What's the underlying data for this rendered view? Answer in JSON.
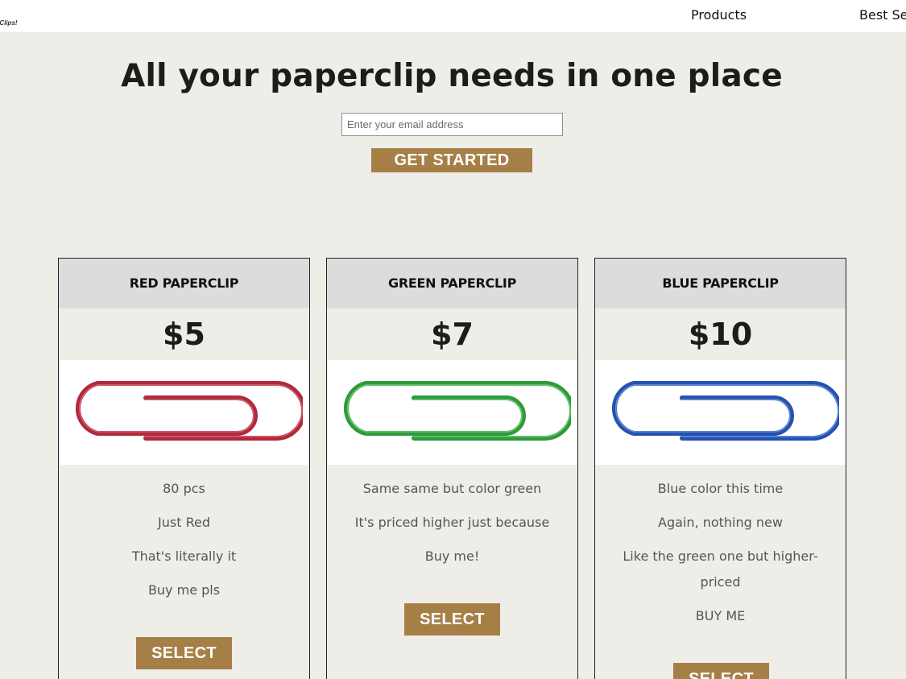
{
  "header": {
    "logo_text": "r Clips!",
    "nav": [
      {
        "label": "Products"
      },
      {
        "label": "Best Se"
      }
    ]
  },
  "hero": {
    "title": "All your paperclip needs in one place",
    "email_placeholder": "Enter your email address",
    "cta_label": "GET STARTED"
  },
  "colors": {
    "accent": "#a67f46",
    "background": "#eeede8",
    "card_header": "#dcdcdc",
    "red_clip": "#b02a3c",
    "green_clip": "#2f9a3a",
    "blue_clip": "#2552b0"
  },
  "products": [
    {
      "name": "RED PAPERCLIP",
      "price": "$5",
      "image_icon": "red-paperclip",
      "features": [
        "80 pcs",
        "Just Red",
        "That's literally it",
        "Buy me pls"
      ],
      "button_label": "SELECT"
    },
    {
      "name": "GREEN PAPERCLIP",
      "price": "$7",
      "image_icon": "green-paperclip",
      "features": [
        "Same same but color green",
        "It's priced higher just because",
        "Buy me!"
      ],
      "button_label": "SELECT"
    },
    {
      "name": "BLUE PAPERCLIP",
      "price": "$10",
      "image_icon": "blue-paperclip",
      "features": [
        "Blue color this time",
        "Again, nothing new",
        "Like the green one but higher-priced",
        "BUY ME"
      ],
      "button_label": "SELECT"
    }
  ]
}
